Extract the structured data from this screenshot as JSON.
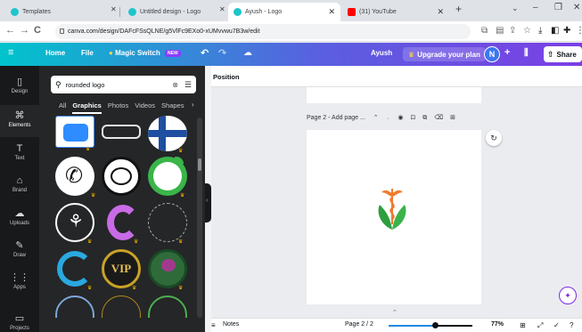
{
  "browser": {
    "tabs": [
      {
        "label": "Templates",
        "favicon_color": "#20c4cb"
      },
      {
        "label": "Untitled design - Logo",
        "favicon_color": "#20c4cb"
      },
      {
        "label": "Ayush - Logo",
        "favicon_color": "#20c4cb"
      },
      {
        "label": "(31) YouTube",
        "favicon_color": "#ff0000"
      }
    ],
    "new_tab": "+",
    "url": "canva.com/design/DAFcFSsQLNE/g5VlFc9EXo0-xUMvvwu7B3w/edit"
  },
  "topbar": {
    "menu_icon": "≡",
    "home": "Home",
    "file": "File",
    "magic_switch": "Magic Switch",
    "magic_badge": "NEW",
    "user_name": "Ayush",
    "upgrade": "Upgrade your plan",
    "avatar_initial": "N",
    "share": "Share"
  },
  "rail": [
    {
      "label": "Design",
      "icon": "▯"
    },
    {
      "label": "Elements",
      "icon": "⌘"
    },
    {
      "label": "Text",
      "icon": "T"
    },
    {
      "label": "Brand",
      "icon": "⌂"
    },
    {
      "label": "Uploads",
      "icon": "☁"
    },
    {
      "label": "Draw",
      "icon": "✎"
    },
    {
      "label": "Apps",
      "icon": "⋮⋮"
    },
    {
      "label": "Projects",
      "icon": "▭"
    }
  ],
  "panel": {
    "search_value": "rounded logo",
    "filters": [
      "All",
      "Graphics",
      "Photos",
      "Videos",
      "Shapes"
    ],
    "selected_filter": "Graphics",
    "crown": "♛",
    "vip_text": "VIP"
  },
  "editor": {
    "position_label": "Position",
    "page2_title": "Page 2 - Add page ...",
    "refresh_icon": "↻",
    "magic_icon": "✦"
  },
  "bottombar": {
    "notes": "Notes",
    "page_indicator": "Page 2 / 2",
    "zoom": "77%",
    "zoom_fraction": 0.55
  },
  "colors": {
    "canva_gradient_start": "#00c4cc",
    "canva_gradient_end": "#7b3fe4",
    "zoom_blue": "#1e88e5",
    "logo_green": "#2e9e3e",
    "logo_orange": "#f07b2b"
  }
}
